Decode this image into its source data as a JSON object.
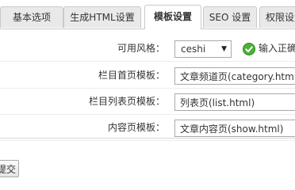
{
  "tabs": [
    {
      "label": "基本选项",
      "active": false
    },
    {
      "label": "生成HTML设置",
      "active": false
    },
    {
      "label": "模板设置",
      "active": true
    },
    {
      "label": "SEO 设置",
      "active": false
    },
    {
      "label": "权限设置",
      "active": false
    }
  ],
  "form": {
    "style": {
      "label": "可用风格：",
      "selected": "ceshi",
      "status_text": "输入正确",
      "status_color": "#3a9a2c"
    },
    "category_template": {
      "label": "栏目首页模板：",
      "value": "文章频道页(category.html)"
    },
    "list_template": {
      "label": "栏目列表页模板：",
      "value": "列表页(list.html)"
    },
    "content_template": {
      "label": "内容页模板：",
      "value": "文章内容页(show.html)"
    }
  },
  "submit_label": "提交"
}
